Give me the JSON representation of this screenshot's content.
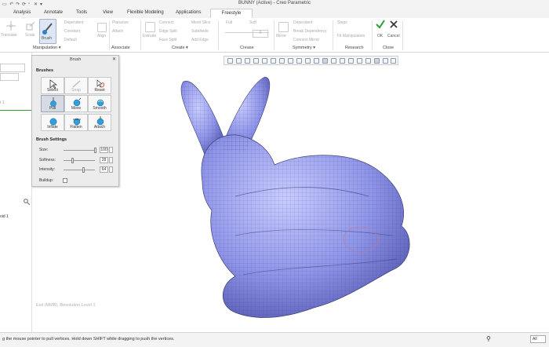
{
  "window": {
    "title": "BUNNY (Active) - Creo Parametric"
  },
  "tabs": [
    {
      "label": "Analysis"
    },
    {
      "label": "Annotate"
    },
    {
      "label": "Tools"
    },
    {
      "label": "View"
    },
    {
      "label": "Flexible Modeling"
    },
    {
      "label": "Applications"
    },
    {
      "label": "Freestyle",
      "active": true
    }
  ],
  "ribbon": {
    "manipulation": {
      "translate": "Translate",
      "scale": "Scale",
      "brush": "Brush",
      "dependent": "Dependent",
      "constant": "Constant",
      "default": "Default",
      "align": "Align",
      "group_label": "Manipulation ▾"
    },
    "associate": {
      "planarize": "Planarize",
      "attach": "Attach",
      "group_label": "Associate"
    },
    "create": {
      "extrude": "Extrude",
      "connect": "Connect",
      "edge_split": "Edge Split",
      "face_split": "Face Split",
      "mesh_slice": "Mesh Slice",
      "subdivide": "Subdivide",
      "add_edge": "Add Edge",
      "group_label": "Create ▾"
    },
    "crease": {
      "full": "Full",
      "soft": "Soft",
      "value": "0",
      "group_label": "Crease"
    },
    "symmetry": {
      "mirror": "Mirror",
      "dependent": "Dependent",
      "break_dependency": "Break Dependency",
      "connect_mirror": "Connect Mirror",
      "group_label": "Symmetry ▾"
    },
    "research": {
      "steps": "Steps",
      "fit_manipulation": "Fit Manipulation",
      "group_label": "Research"
    },
    "close": {
      "ok": "OK",
      "cancel": "Cancel",
      "group_label": "Close"
    }
  },
  "left_panel": {
    "text1": "t 1",
    "text2": "oid 1"
  },
  "brush_dialog": {
    "title": "Brush",
    "brushes_label": "Brushes",
    "buttons": [
      {
        "label": "Select",
        "icon": "cursor-icon",
        "enabled": true
      },
      {
        "label": "Snap",
        "icon": "snap-icon",
        "enabled": false
      },
      {
        "label": "Reset",
        "icon": "reset-icon",
        "enabled": true
      },
      {
        "label": "Pull",
        "icon": "pull-icon",
        "enabled": true,
        "selected": true
      },
      {
        "label": "Move",
        "icon": "move-icon",
        "enabled": true
      },
      {
        "label": "Smooth",
        "icon": "smooth-icon",
        "enabled": true
      },
      {
        "label": "Inflate",
        "icon": "inflate-icon",
        "enabled": true
      },
      {
        "label": "Flatten",
        "icon": "flatten-icon",
        "enabled": true
      },
      {
        "label": "Attach",
        "icon": "attach-icon",
        "enabled": true
      }
    ],
    "settings_label": "Brush Settings",
    "size": {
      "label": "Size:",
      "value": "100",
      "fraction": 1.0
    },
    "softness": {
      "label": "Softness:",
      "value": "28",
      "fraction": 0.28
    },
    "intensity": {
      "label": "Intensity:",
      "value": "64",
      "fraction": 0.64
    },
    "buildup": {
      "label": "Buildup:",
      "checked": false
    }
  },
  "viewport": {
    "watermark": "Exit (MMB), Resolution Level 1"
  },
  "status": {
    "message": "g the mouse pointer to pull vertices. Hold down SHIFT while dragging to push the vertices.",
    "filter": "All"
  },
  "colors": {
    "accent": "#2f7fd0",
    "mesh": "#8f95e8",
    "ok_green": "#2aa02a",
    "cancel": "#333333"
  }
}
